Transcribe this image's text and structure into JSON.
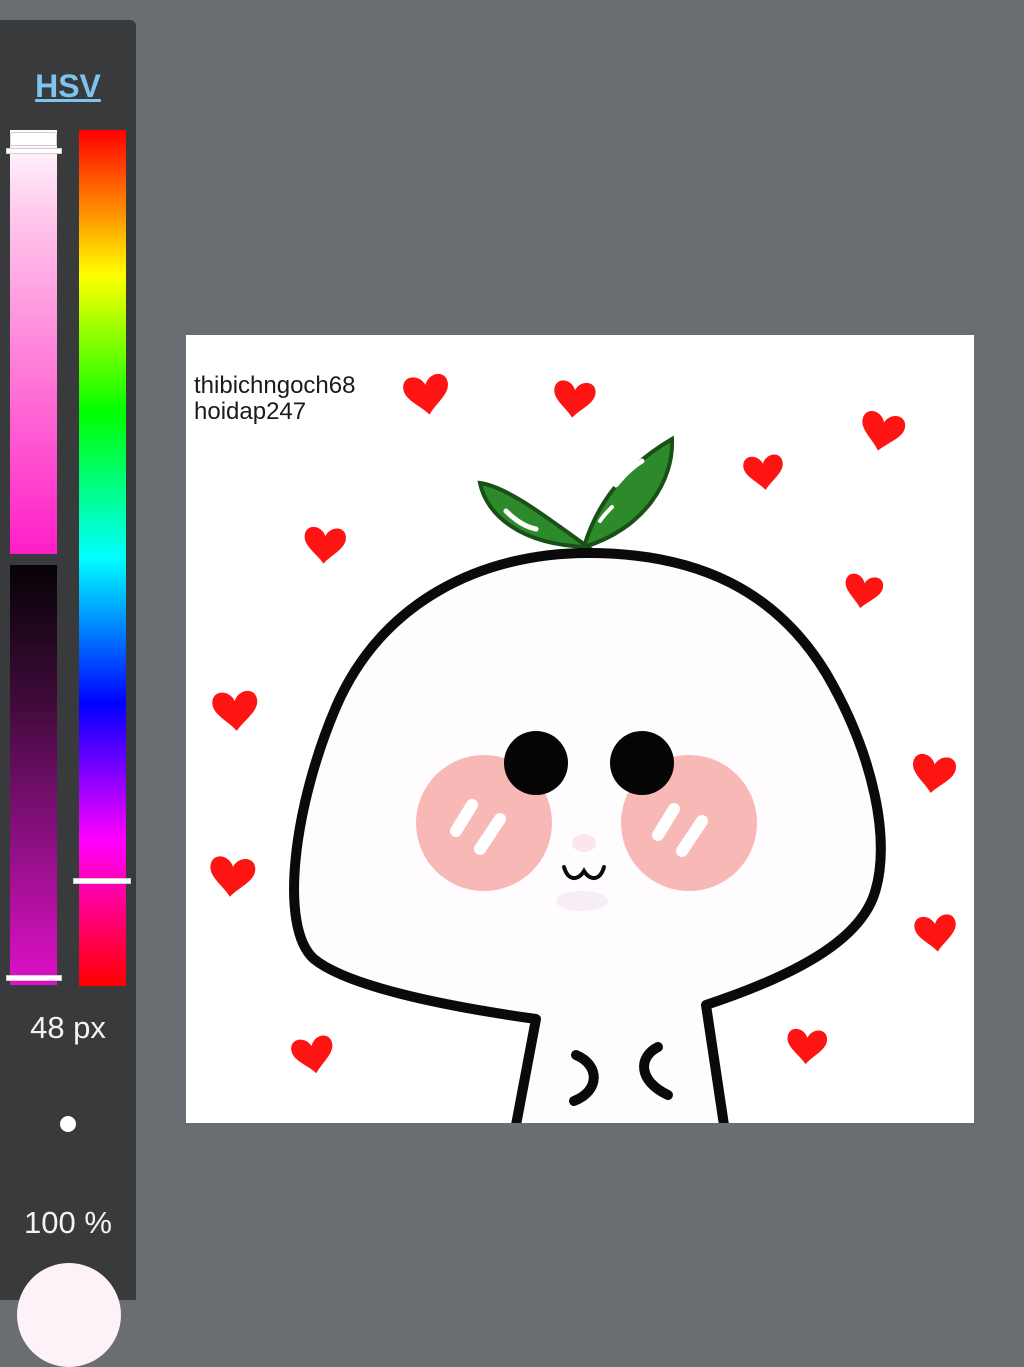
{
  "panel": {
    "mode_label": "HSV",
    "brush_size": "48 px",
    "opacity": "100 %"
  },
  "canvas": {
    "watermark_line1": "thibichngoch68",
    "watermark_line2": "hoidap247"
  },
  "colors": {
    "panel_bg": "#393a3c",
    "workspace_bg": "#6a6d72",
    "accent": "#7fc4ef",
    "selected_color": "#fdf2f8",
    "heart": "#ff1414",
    "leaf": "#2d8a2a",
    "blush": "#f8b8b5"
  }
}
